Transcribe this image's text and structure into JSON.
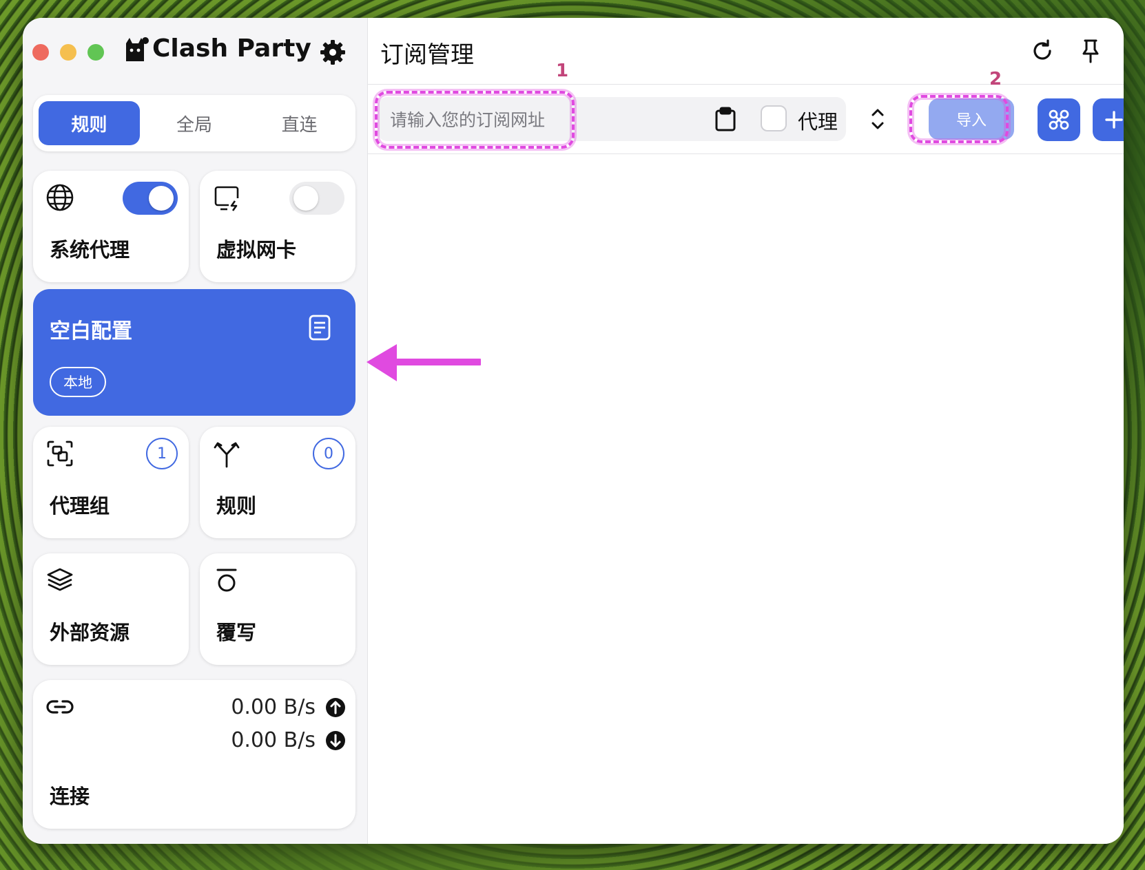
{
  "window": {
    "title": "Clash Party"
  },
  "sidebar": {
    "mode_tabs": [
      {
        "label": "规则",
        "active": true
      },
      {
        "label": "全局",
        "active": false
      },
      {
        "label": "直连",
        "active": false
      }
    ],
    "system_proxy": {
      "label": "系统代理",
      "icon": "globe-icon",
      "enabled": true
    },
    "virtual_nic": {
      "label": "虚拟网卡",
      "icon": "monitor-bolt-icon",
      "enabled": false
    },
    "profile": {
      "name": "空白配置",
      "tag": "本地",
      "icon": "document-icon"
    },
    "proxy_groups": {
      "label": "代理组",
      "count": "1",
      "icon": "group-icon"
    },
    "rules": {
      "label": "规则",
      "count": "0",
      "icon": "fork-icon"
    },
    "resources": {
      "label": "外部资源",
      "icon": "layers-icon"
    },
    "override": {
      "label": "覆写",
      "icon": "override-icon"
    },
    "connections": {
      "label": "连接",
      "upload": "0.00 B/s",
      "download": "0.00 B/s",
      "icon": "link-icon"
    }
  },
  "main": {
    "title": "订阅管理",
    "toolbar": {
      "url_placeholder": "请输入您的订阅网址",
      "url_value": "",
      "proxy_label": "代理",
      "proxy_checked": false,
      "import_label": "导入"
    }
  },
  "annotations": {
    "marker1": "1",
    "marker2": "2"
  },
  "colors": {
    "accent": "#4169e1",
    "import_disabled": "#93a9f0",
    "annotation": "#e04ae0"
  }
}
